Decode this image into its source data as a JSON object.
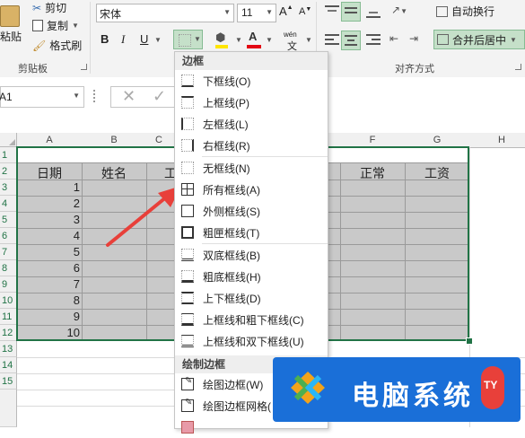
{
  "clipboard": {
    "paste_label": "粘贴",
    "cut_label": "剪切",
    "copy_label": "复制",
    "painter_label": "格式刷",
    "group_label": "剪贴板"
  },
  "font": {
    "name_value": "宋体",
    "size_value": "11",
    "grow_label": "A",
    "shrink_label": "A",
    "bold_label": "B",
    "italic_label": "I",
    "underline_label": "U",
    "phonetic_label": "wén"
  },
  "alignment": {
    "wrap_label": "自动换行",
    "merge_label": "合并后居中",
    "group_label": "对齐方式"
  },
  "formula_bar": {
    "name_box": "A1"
  },
  "sheet": {
    "columns": [
      "A",
      "B",
      "C",
      "F",
      "G",
      "H"
    ],
    "rows": [
      "1",
      "2",
      "3",
      "4",
      "5",
      "6",
      "7",
      "8",
      "9",
      "10",
      "11",
      "12",
      "13",
      "14",
      "15"
    ],
    "header_cells": [
      "日期",
      "姓名",
      "工",
      "正常",
      "工资"
    ],
    "dates": [
      "1",
      "2",
      "3",
      "4",
      "5",
      "6",
      "7",
      "8",
      "9",
      "10"
    ]
  },
  "menu": {
    "section1": "边框",
    "items1": [
      {
        "label": "下框线(O)",
        "icon": "bottom-border-icon"
      },
      {
        "label": "上框线(P)",
        "icon": "top-border-icon"
      },
      {
        "label": "左框线(L)",
        "icon": "left-border-icon"
      },
      {
        "label": "右框线(R)",
        "icon": "right-border-icon"
      }
    ],
    "items2": [
      {
        "label": "无框线(N)",
        "icon": "no-border-icon"
      },
      {
        "label": "所有框线(A)",
        "icon": "all-borders-icon"
      },
      {
        "label": "外侧框线(S)",
        "icon": "outside-borders-icon"
      },
      {
        "label": "粗匣框线(T)",
        "icon": "thick-box-border-icon"
      }
    ],
    "items3": [
      {
        "label": "双底框线(B)",
        "icon": "bottom-double-border-icon"
      },
      {
        "label": "粗底框线(H)",
        "icon": "thick-bottom-border-icon"
      },
      {
        "label": "上下框线(D)",
        "icon": "top-bottom-border-icon"
      },
      {
        "label": "上框线和粗下框线(C)",
        "icon": "top-thick-bottom-border-icon"
      },
      {
        "label": "上框线和双下框线(U)",
        "icon": "top-double-bottom-border-icon"
      }
    ],
    "section2": "绘制边框",
    "items4": [
      {
        "label": "绘图边框(W)",
        "icon": "draw-border-icon"
      },
      {
        "label": "绘图边框网格(",
        "icon": "draw-border-grid-icon"
      }
    ]
  },
  "watermark": {
    "text": "电脑系统",
    "badge": "TY"
  },
  "colors": {
    "accent_green": "#217346",
    "selected_gray": "#c9c9c9",
    "arrow_red": "#e8403a",
    "watermark_blue": "#1a6fd8"
  }
}
